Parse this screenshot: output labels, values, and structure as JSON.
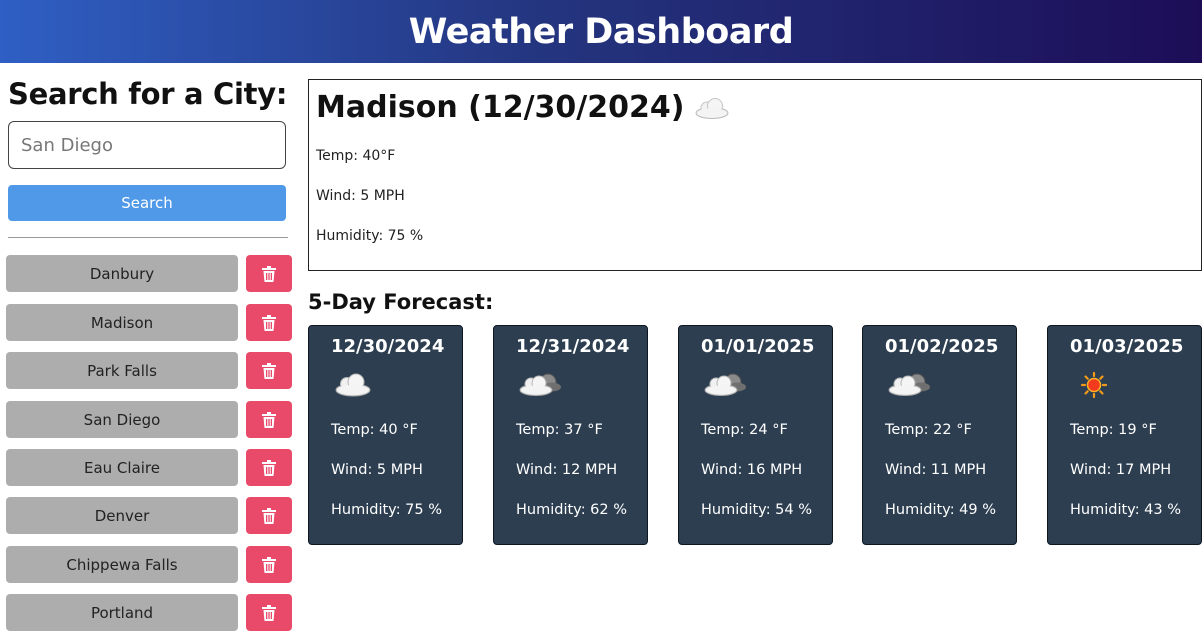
{
  "header": {
    "title": "Weather Dashboard"
  },
  "search": {
    "title": "Search for a City:",
    "placeholder": "San Diego",
    "value": "",
    "button_label": "Search"
  },
  "history": [
    {
      "city": "Danbury"
    },
    {
      "city": "Madison"
    },
    {
      "city": "Park Falls"
    },
    {
      "city": "San Diego"
    },
    {
      "city": "Eau Claire"
    },
    {
      "city": "Denver"
    },
    {
      "city": "Chippewa Falls"
    },
    {
      "city": "Portland"
    }
  ],
  "icons": {
    "delete": "trash-icon",
    "cloud": "cloud-icon",
    "partly_cloudy": "partly-cloudy-icon",
    "sun": "sun-icon"
  },
  "colors": {
    "delete_button": "#e94a6a",
    "search_button": "#4f99e8",
    "card_bg": "#2c3e50",
    "history_button": "#adadad"
  },
  "current": {
    "title": "Madison (12/30/2024)",
    "icon": "cloud-icon",
    "temp": "Temp: 40°F",
    "wind": "Wind: 5 MPH",
    "humidity": "Humidity: 75 %"
  },
  "forecast": {
    "title": "5-Day Forecast:",
    "days": [
      {
        "date": "12/30/2024",
        "icon": "cloud-icon",
        "temp": "Temp: 40 °F",
        "wind": "Wind: 5 MPH",
        "humidity": "Humidity: 75 %"
      },
      {
        "date": "12/31/2024",
        "icon": "partly-cloudy-icon",
        "temp": "Temp: 37 °F",
        "wind": "Wind: 12 MPH",
        "humidity": "Humidity: 62 %"
      },
      {
        "date": "01/01/2025",
        "icon": "partly-cloudy-icon",
        "temp": "Temp: 24 °F",
        "wind": "Wind: 16 MPH",
        "humidity": "Humidity: 54 %"
      },
      {
        "date": "01/02/2025",
        "icon": "partly-cloudy-icon",
        "temp": "Temp: 22 °F",
        "wind": "Wind: 11 MPH",
        "humidity": "Humidity: 49 %"
      },
      {
        "date": "01/03/2025",
        "icon": "sun-icon",
        "temp": "Temp: 19 °F",
        "wind": "Wind: 17 MPH",
        "humidity": "Humidity: 43 %"
      }
    ]
  }
}
